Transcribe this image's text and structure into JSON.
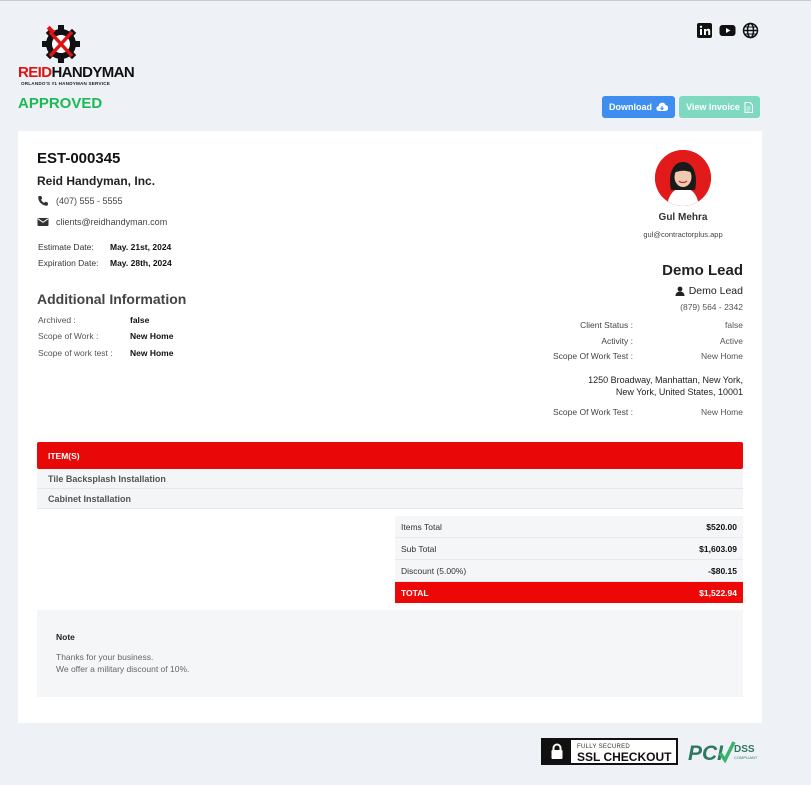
{
  "brand": {
    "name_red": "REID",
    "name_black": "HANDYMAN",
    "tagline": "ORLANDO'S #1 HANDYMAN SERVICE",
    "accent": "#e80808"
  },
  "social": [
    "linkedin-icon",
    "youtube-icon",
    "globe-icon"
  ],
  "status": "APPROVED",
  "actions": {
    "download": "Download",
    "view_invoice": "View Invoice"
  },
  "estimate": {
    "number": "EST-000345",
    "company": "Reid Handyman, Inc.",
    "phone": "(407) 555 - 5555",
    "email": "clients@reidhandyman.com",
    "estimate_date_label": "Estimate Date:",
    "estimate_date": "May. 21st, 2024",
    "expiration_date_label": "Expiration Date:",
    "expiration_date": "May. 28th, 2024"
  },
  "additional": {
    "title": "Additional Information",
    "rows": [
      {
        "label": "Archived :",
        "value": "false"
      },
      {
        "label": "Scope of Work :",
        "value": "New Home"
      },
      {
        "label": "Scope of work test :",
        "value": "New Home"
      }
    ]
  },
  "rep": {
    "name": "Gul Mehra",
    "email": "gul@contractorplus.app"
  },
  "lead": {
    "title": "Demo Lead",
    "name": "Demo Lead",
    "phone": "(879) 564 - 2342",
    "rows": [
      {
        "label": "Client Status :",
        "value": "false"
      },
      {
        "label": "Activity :",
        "value": "Active"
      },
      {
        "label": "Scope Of Work Test :",
        "value": "New Home"
      }
    ],
    "address_line1": "1250 Broadway, Manhattan, New York,",
    "address_line2": "New York, United States, 10001",
    "extra_row": {
      "label": "Scope Of Work Test :",
      "value": "New Home"
    }
  },
  "items": {
    "header": "ITEM(S)",
    "list": [
      "Tile Backsplash Installation",
      "Cabinet Installation"
    ]
  },
  "totals": [
    {
      "label": "Items Total",
      "value": "$520.00"
    },
    {
      "label": "Sub Total",
      "value": "$1,603.09"
    },
    {
      "label": "Discount (5.00%)",
      "value": "-$80.15"
    },
    {
      "label": "TOTAL",
      "value": "$1,522.94"
    }
  ],
  "note": {
    "title": "Note",
    "line1": "Thanks for your business.",
    "line2": "We offer a military discount of 10%."
  },
  "badges": {
    "ssl_small": "FULLY SECURED",
    "ssl_big": "SSL CHECKOUT",
    "pci": "PCI",
    "dss": "DSS",
    "compliant": "COMPLIANT"
  }
}
